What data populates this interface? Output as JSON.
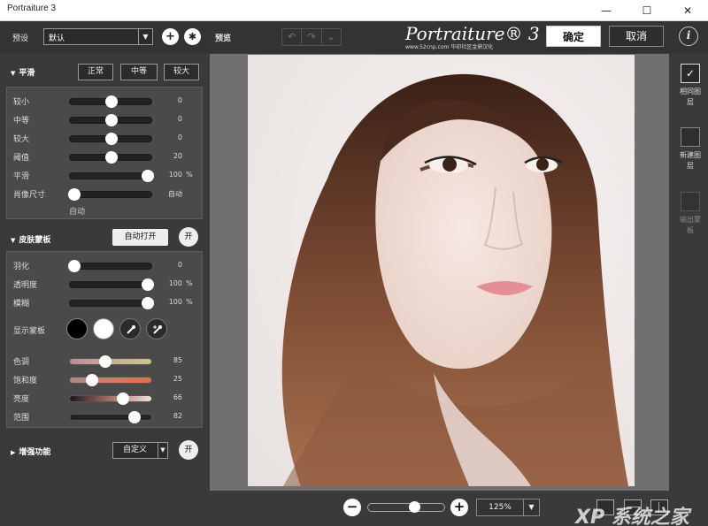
{
  "window": {
    "title": "Portraiture 3",
    "minimize": "—",
    "maximize": "☐",
    "close": "✕"
  },
  "toolbar": {
    "preset_label": "预设",
    "preset_value": "默认",
    "preview_label": "预览",
    "logo": "Portraiture® 3",
    "logo_sub": "www.52cnp.com  华印社区金鼎汉化",
    "ok": "确定",
    "cancel": "取消",
    "info": "i"
  },
  "smoothing": {
    "title": "平滑",
    "modes": [
      "正常",
      "中等",
      "较大"
    ],
    "rows": [
      {
        "label": "较小",
        "value": "0",
        "unit": "",
        "level": 0.5
      },
      {
        "label": "中等",
        "value": "0",
        "unit": "",
        "level": 0.5
      },
      {
        "label": "较大",
        "value": "0",
        "unit": "",
        "level": 0.5
      },
      {
        "label": "阈值",
        "value": "20",
        "unit": "",
        "level": 0.5
      },
      {
        "label": "平滑",
        "value": "100",
        "unit": "%",
        "level": 0.94
      },
      {
        "label": "肖像尺寸",
        "value": "自动",
        "unit": "",
        "level": 0.05
      }
    ],
    "size_note": "自动"
  },
  "skin_mask": {
    "title": "皮肤蒙板",
    "auto_button": "自动打开",
    "toggle": "开",
    "rows": [
      {
        "label": "羽化",
        "value": "0",
        "unit": "",
        "level": 0.05
      },
      {
        "label": "透明度",
        "value": "100",
        "unit": "%",
        "level": 0.94
      },
      {
        "label": "模糊",
        "value": "100",
        "unit": "%",
        "level": 0.94
      }
    ],
    "show_mask": "显示蒙板",
    "color_rows": [
      {
        "label": "色调",
        "value": "85",
        "level": 0.43,
        "gradient": "linear-gradient(90deg,#c08a9a,#c6b08e,#c8c48c)"
      },
      {
        "label": "饱和度",
        "value": "25",
        "level": 0.27,
        "gradient": "linear-gradient(90deg,#a88,#d77a66,#e86a4a)"
      },
      {
        "label": "亮度",
        "value": "66",
        "level": 0.64,
        "gradient": "linear-gradient(90deg,#1a1a1a,#a8706a,#f3e0e0)"
      },
      {
        "label": "范围",
        "value": "82",
        "level": 0.78,
        "gradient": "#222"
      }
    ],
    "colors": {
      "mask_black": "#000000",
      "mask_white": "#ffffff"
    }
  },
  "enhance": {
    "title": "增强功能",
    "preset": "自定义",
    "toggle": "开"
  },
  "right_panel": {
    "same_layer": "相同图层",
    "new_layer": "新建图层",
    "output_mask": "输出蒙板",
    "check": "✓"
  },
  "bottom": {
    "zoom_out": "−",
    "zoom_in": "+",
    "zoom_value": "125%",
    "zoom_level": 0.6,
    "watermark": "XP 系统之家 .com"
  }
}
